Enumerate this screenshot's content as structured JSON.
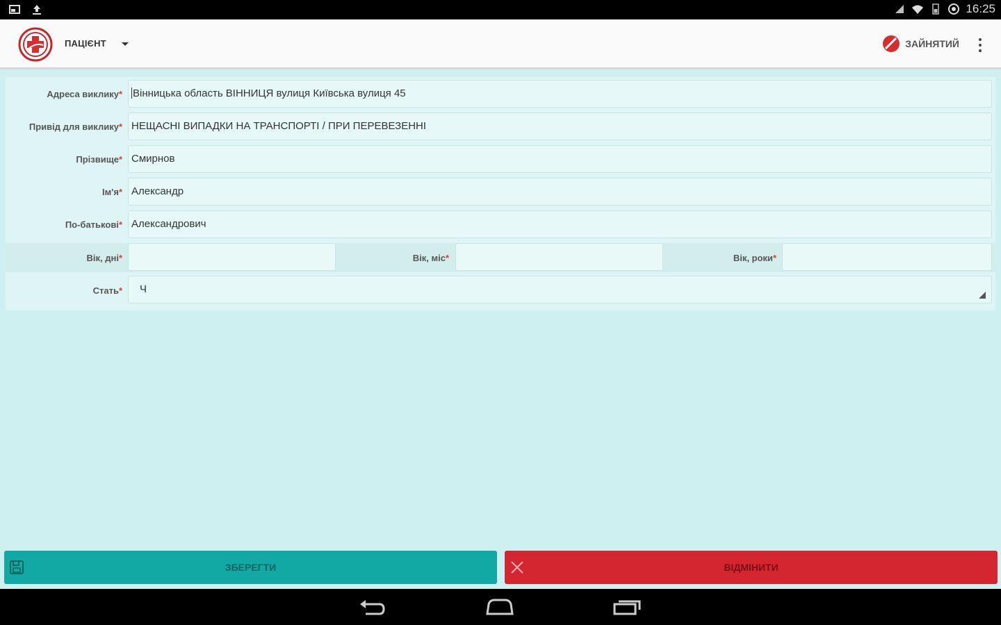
{
  "status_bar": {
    "time": "16:25",
    "icons": [
      "screenshot-icon",
      "upload-icon",
      "signal-icon",
      "wifi-icon",
      "battery-icon",
      "sync-icon"
    ]
  },
  "app_bar": {
    "title": "ПАЦІЄНТ",
    "busy_label": "ЗАЙНЯТИЙ"
  },
  "form": {
    "address": {
      "label": "Адреса виклику",
      "value": "Вінницька область ВІННИЦЯ вулиця Київська вулиця 45"
    },
    "reason": {
      "label": "Привід для виклику",
      "value": "НЕЩАСНІ ВИПАДКИ НА ТРАНСПОРТІ / ПРИ ПЕРЕВЕЗЕННІ"
    },
    "surname": {
      "label": "Прізвище",
      "value": "Смирнов"
    },
    "name": {
      "label": "Ім'я",
      "value": "Александр"
    },
    "patronymic": {
      "label": "По-батькові",
      "value": "Александрович"
    },
    "age_days": {
      "label": "Вік, дні",
      "value": ""
    },
    "age_months": {
      "label": "Вік, міс",
      "value": ""
    },
    "age_years": {
      "label": "Вік, роки",
      "value": ""
    },
    "sex": {
      "label": "Стать",
      "value": "Ч"
    },
    "required_mark": "*"
  },
  "buttons": {
    "save": "ЗБЕРЕГТИ",
    "cancel": "ВІДМІНИТИ"
  },
  "colors": {
    "background": "#cff0f0",
    "save": "#12a8a4",
    "cancel": "#d32630",
    "required": "#e53935"
  }
}
